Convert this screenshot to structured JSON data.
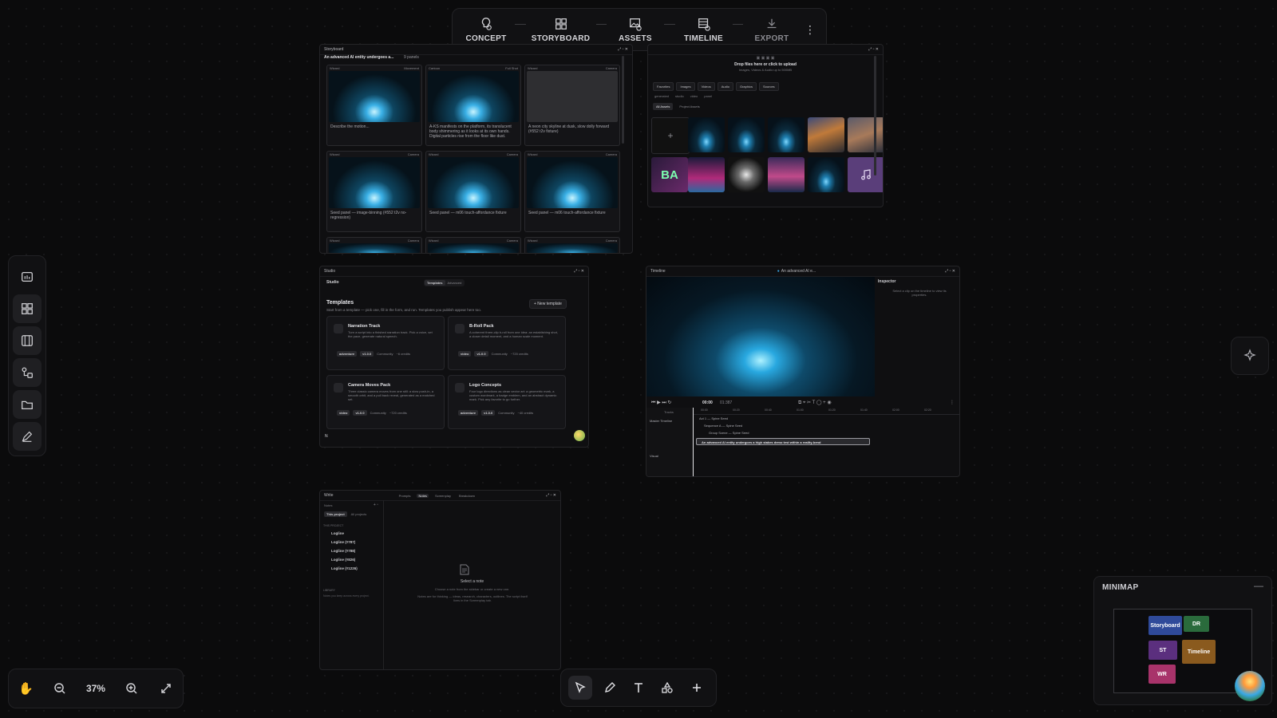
{
  "pipeline": {
    "stages": [
      {
        "label": "CONCEPT",
        "icon": "lightbulb-icon"
      },
      {
        "label": "STORYBOARD",
        "icon": "grid-icon"
      },
      {
        "label": "ASSETS",
        "icon": "image-icon"
      },
      {
        "label": "TIMELINE",
        "icon": "film-icon"
      },
      {
        "label": "EXPORT",
        "icon": "download-icon"
      }
    ],
    "more": "⋮"
  },
  "storyboard": {
    "window_title": "Storyboard",
    "project_title": "An advanced AI entity undergoes a...",
    "panel_count": "9 panels",
    "cards": [
      {
        "tag": "Wizard",
        "shot": "Movement",
        "desc": "Describe the motion..."
      },
      {
        "tag": "Cartoon",
        "shot": "Full Shot",
        "desc": "A-KS manifests on the platform, its translucent body shimmering as it looks at its own hands. Digital particles rise from the floor like dust."
      },
      {
        "tag": "Wizard",
        "shot": "Camera",
        "desc": "A neon city skyline at dusk, slow dolly forward (#552 t2v fixture)"
      },
      {
        "tag": "Wizard",
        "shot": "Camera",
        "desc": "Seed panel — image-binning (#552 t2v no-regression)"
      },
      {
        "tag": "Wizard",
        "shot": "Camera",
        "desc": "Seed panel — m06 touch-affordance fixture"
      },
      {
        "tag": "Wizard",
        "shot": "Camera",
        "desc": "Seed panel — m06 touch-affordance fixture"
      },
      {
        "tag": "Wizard",
        "shot": "Camera",
        "desc": ""
      },
      {
        "tag": "Wizard",
        "shot": "Camera",
        "desc": ""
      },
      {
        "tag": "Wizard",
        "shot": "Camera",
        "desc": ""
      }
    ]
  },
  "assets": {
    "drop_title": "Drop files here or click to upload",
    "drop_sub": "Images, Videos & Audio up to 500MB",
    "filters": [
      "Favorites",
      "Images",
      "Videos",
      "Audio",
      "Graphics",
      "Sources"
    ],
    "sub_filters": [
      "generated",
      "studio",
      "video",
      "panel"
    ],
    "scopes": [
      "All Assets",
      "Project Assets"
    ],
    "add": "+",
    "overlay_text": "BA"
  },
  "studio": {
    "window_title": "Studio",
    "header": "Studio",
    "tabs": [
      "Templates",
      "Advanced"
    ],
    "heading": "Templates",
    "subheading": "Start from a template — pick one, fill in the form, and run. Templates you publish appear here too.",
    "new_button": "+ New template",
    "templates": [
      {
        "title": "Narration Track",
        "desc": "Turn a script into a finished narration track. Pick a voice, set the pace, generate natural speech.",
        "kind": "adventure",
        "version": "v1.0.0",
        "source": "Community",
        "credits": "~6 credits"
      },
      {
        "title": "B-Roll Pack",
        "desc": "A coherent three-clip b-roll from one idea: an establishing shot, a closer detail moment, and a human scale moment.",
        "kind": "video",
        "version": "v1.0.0",
        "source": "Community",
        "credits": "~720 credits"
      },
      {
        "title": "Camera Moves Pack",
        "desc": "Three classic camera moves from one still: a slow push-in, a smooth orbit, and a pull back reveal, generated as a matched set.",
        "kind": "video",
        "version": "v1.0.0",
        "source": "Community",
        "credits": "~720 credits"
      },
      {
        "title": "Logo Concepts",
        "desc": "Four logo directions as clean vector art: a geometric mark, a custom wordmark, a badge emblem, and an abstract dynamic mark. Pick any favorite to go further.",
        "kind": "adventure",
        "version": "v1.0.0",
        "source": "Community",
        "credits": "~40 credits"
      }
    ],
    "user_initial": "N"
  },
  "timeline": {
    "window_title": "Timeline",
    "project": "An advanced AI e...",
    "inspector_title": "Inspector",
    "inspector_hint": "Select a clip on the timeline to view its properties.",
    "time_current": "00:00",
    "time_total": "01:387",
    "tracks_label": "Tracks",
    "tracks": [
      "Master Timeline",
      "Visual"
    ],
    "ruler": [
      "00:00",
      "00:20",
      "00:40",
      "01:00",
      "01:20",
      "01:40",
      "02:00",
      "02:20"
    ],
    "rows": [
      {
        "type": "scene",
        "label": "Act 1 — Spine Seed"
      },
      {
        "type": "sequence",
        "label": "Sequence A — Spine Seed"
      },
      {
        "type": "shot",
        "label": "Group Scene — Spine Seed"
      },
      {
        "type": "clip",
        "label": "An advanced AI entity undergoes a high stakes demo test within a reality-bend"
      }
    ]
  },
  "write": {
    "window_title": "Write",
    "tabs": [
      "Prompts",
      "Notes",
      "Screenplay",
      "Breakdown"
    ],
    "active_tab": "Notes",
    "notes_label": "Notes",
    "scope_tabs": [
      "This project",
      "All projects"
    ],
    "section_label": "THIS PROJECT",
    "notes": [
      "Logline",
      "Logline (#787)",
      "Logline (#788)",
      "Logline (#826)",
      "Logline (#1226)"
    ],
    "library_label": "LIBRARY",
    "library_hint": "Notes you keep across every project.",
    "empty_title": "Select a note",
    "empty_hint": "Choose a note from the sidebar or create a new one.",
    "empty_hint2": "Notes are for thinking — ideas, research, characters, outlines. The script itself lives in the Screenplay tab."
  },
  "zoom": {
    "level": "37%"
  },
  "minimap": {
    "title": "MINIMAP",
    "collapse": "—",
    "blocks": [
      {
        "label": "Storyboard",
        "color": "#2f4a9a"
      },
      {
        "label": "DR",
        "color": "#2a6b3c"
      },
      {
        "label": "ST",
        "color": "#5b2f7e"
      },
      {
        "label": "Timeline",
        "color": "#8a5a1e"
      },
      {
        "label": "WR",
        "color": "#a8336a"
      }
    ]
  },
  "colors": {
    "accent": "#3aa8e6",
    "panel_bg": "#0f0f11",
    "canvas_bg": "#0b0b0c"
  }
}
